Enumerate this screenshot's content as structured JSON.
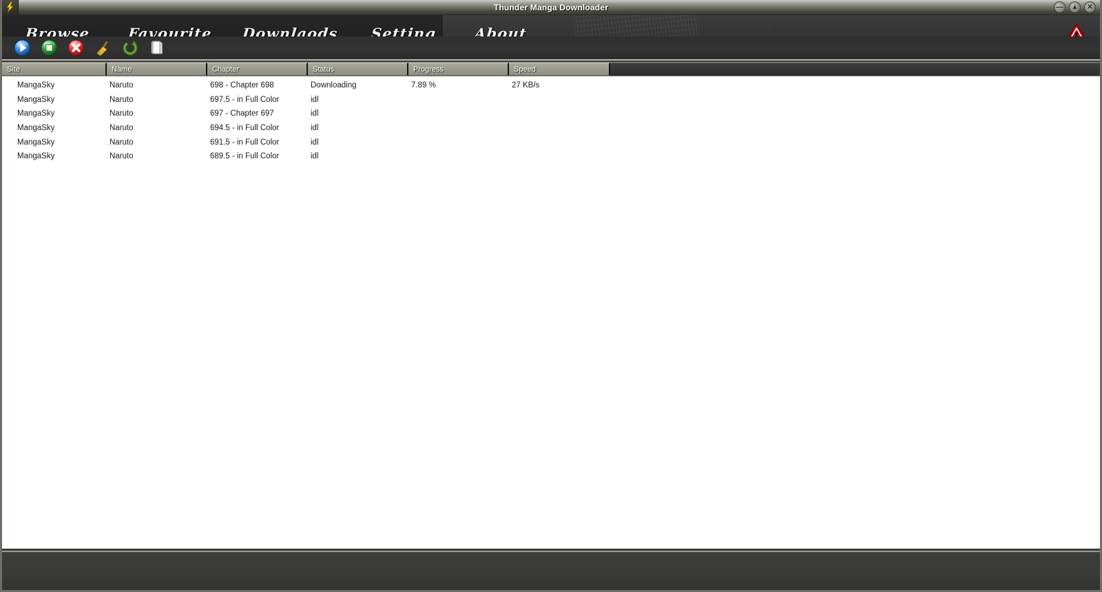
{
  "window": {
    "title": "Thunder Manga Downloader",
    "app_icon": "lightning-bolt-icon",
    "controls": [
      {
        "name": "minimize",
        "glyph": "—"
      },
      {
        "name": "maximize",
        "glyph": "▲"
      },
      {
        "name": "close",
        "glyph": "✕"
      }
    ]
  },
  "menu": {
    "items": [
      {
        "id": "browse",
        "label": "Browse"
      },
      {
        "id": "favourite",
        "label": "Favourite"
      },
      {
        "id": "downlaods",
        "label": "Downlaods"
      },
      {
        "id": "setting",
        "label": "Setting"
      },
      {
        "id": "about",
        "label": "About"
      }
    ],
    "warning_icon": "warning-triangle-icon"
  },
  "toolbar": {
    "buttons": [
      {
        "id": "start",
        "icon": "play-icon",
        "label": "Start"
      },
      {
        "id": "stop",
        "icon": "stop-icon",
        "label": "Stop"
      },
      {
        "id": "delete",
        "icon": "delete-icon",
        "label": "Delete"
      },
      {
        "id": "clear",
        "icon": "broom-icon",
        "label": "Clear"
      },
      {
        "id": "refresh",
        "icon": "refresh-icon",
        "label": "Refresh"
      },
      {
        "id": "folder",
        "icon": "folder-icon",
        "label": "Open Folder"
      }
    ]
  },
  "download_list": {
    "columns": [
      {
        "id": "site",
        "label": "Site"
      },
      {
        "id": "name",
        "label": "Name"
      },
      {
        "id": "chapter",
        "label": "Chapter"
      },
      {
        "id": "status",
        "label": "Status"
      },
      {
        "id": "progress",
        "label": "Progress"
      },
      {
        "id": "speed",
        "label": "Speed"
      }
    ],
    "rows": [
      {
        "site": "MangaSky",
        "name": "Naruto",
        "chapter": "698 - Chapter 698",
        "status": "Downloading",
        "progress": "7.89 %",
        "speed": "27 KB/s"
      },
      {
        "site": "MangaSky",
        "name": "Naruto",
        "chapter": "697.5 - in Full Color",
        "status": "idl",
        "progress": "",
        "speed": ""
      },
      {
        "site": "MangaSky",
        "name": "Naruto",
        "chapter": "697 - Chapter 697",
        "status": "idl",
        "progress": "",
        "speed": ""
      },
      {
        "site": "MangaSky",
        "name": "Naruto",
        "chapter": "694.5 - in Full Color",
        "status": "idl",
        "progress": "",
        "speed": ""
      },
      {
        "site": "MangaSky",
        "name": "Naruto",
        "chapter": "691.5 - in Full Color",
        "status": "idl",
        "progress": "",
        "speed": ""
      },
      {
        "site": "MangaSky",
        "name": "Naruto",
        "chapter": "689.5 - in Full Color",
        "status": "idl",
        "progress": "",
        "speed": ""
      }
    ]
  },
  "status_bar": {
    "text": ""
  },
  "colors": {
    "title_bar_light": "#c8c9c2",
    "title_bar_dark": "#3a3b31",
    "header_band": "#343434",
    "column_header": "#9b9c8e",
    "list_background": "#ffffff",
    "status_bar": "#3a3a38",
    "accent_warning": "#cc1111",
    "accent_play": "#1f6fd0",
    "accent_stop": "#2f9e3f",
    "accent_delete": "#d02828",
    "accent_refresh": "#4d8f1f"
  }
}
